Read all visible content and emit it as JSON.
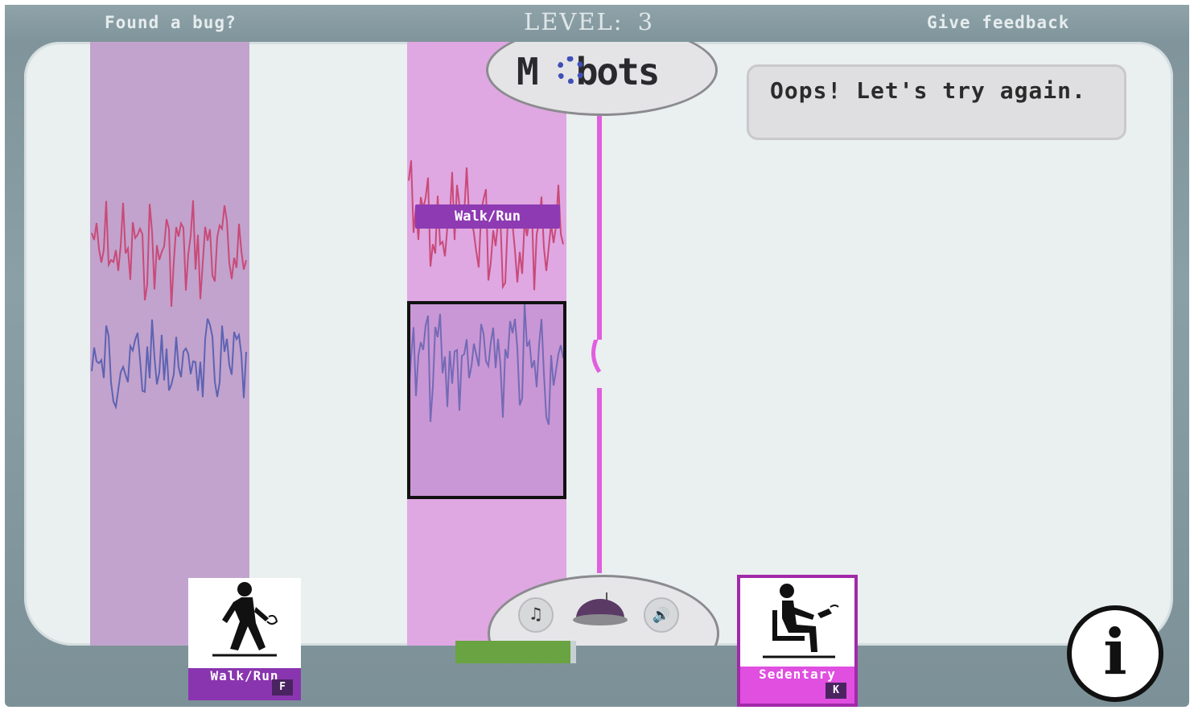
{
  "topbar": {
    "bug_link": "Found a bug?",
    "level_label": "LEVEL:",
    "level_value": "3",
    "feedback_link": "Give feedback"
  },
  "logo": {
    "text": "M bots"
  },
  "message": "Oops! Let's try again.",
  "segment_tag": "Walk/Run",
  "classes": [
    {
      "label": "Walk/Run",
      "key": "F",
      "icon": "walking-person-icon"
    },
    {
      "label": "Sedentary",
      "key": "K",
      "icon": "sitting-person-icon"
    }
  ],
  "controls": {
    "music_icon": "♫",
    "sound_icon": "🔊",
    "robot_icon": "robot-dome-icon"
  },
  "progress": {
    "fraction": 0.95
  },
  "info_icon": "i",
  "colors": {
    "band_a": "#c2a3cd",
    "band_b": "#dfa8e2",
    "wave_red": "#c94a78",
    "wave_blue": "#5d63b3",
    "divider": "#e05fde",
    "progress": "#6aa341"
  }
}
